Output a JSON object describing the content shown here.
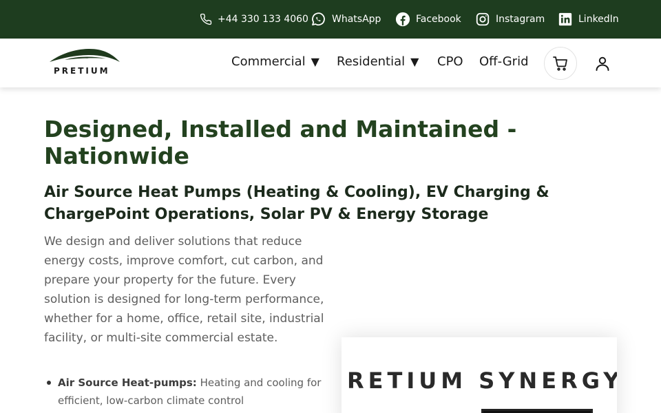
{
  "topbar": {
    "phone": "+44 330 133 4060",
    "whatsapp": "WhatsApp",
    "facebook": "Facebook",
    "instagram": "Instagram",
    "linkedin": "LinkedIn"
  },
  "brand": {
    "logo_text": "PRETIUM"
  },
  "nav": {
    "commercial": "Commercial",
    "residential": "Residential",
    "caret": "▼",
    "cpo": "CPO",
    "offgrid": "Off-Grid"
  },
  "hero": {
    "title": "Designed, Installed and Maintained - Nationwide",
    "subtitle": "Air Source Heat Pumps (Heating & Cooling), EV Charging & ChargePoint Operations, Solar PV & Energy Storage",
    "body": "We design and deliver solutions that reduce energy costs, improve comfort, cut carbon, and prepare your property for the future. Every solution is designed for long-term performance, whether for a home, office, retail site, industrial facility, or multi-site commercial estate.",
    "bullets": [
      {
        "label": "Air Source Heat-pumps:",
        "text": " Heating and cooling for efficient, low-carbon climate control"
      }
    ]
  },
  "promo": {
    "text": "RETIUM SYNERGY"
  },
  "icons": {
    "phone": "phone-icon",
    "whatsapp": "whatsapp-icon",
    "facebook": "facebook-icon",
    "instagram": "instagram-icon",
    "linkedin": "linkedin-icon",
    "cart": "cart-icon",
    "user": "user-icon"
  },
  "colors": {
    "topbar_bg": "#1e3d1f",
    "title_green": "#23421f",
    "body_grey": "#5e5e5e"
  }
}
